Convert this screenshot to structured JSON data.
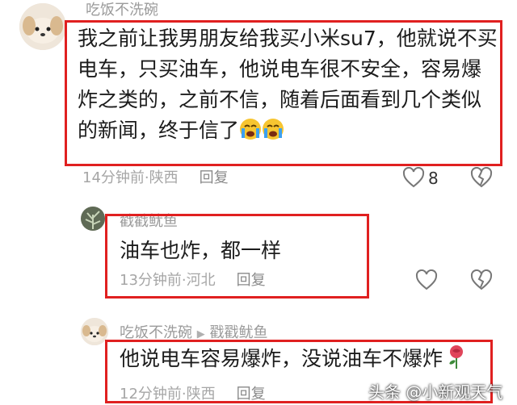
{
  "comments": [
    {
      "username": "吃饭不洗碗",
      "text_lines": [
        "我之前让我男朋友给我买小米su7，他就说不买",
        "电车，只买油车，他说电车很不安全，容易爆",
        "炸之类的，之前不信，随着后面看到几个类似",
        "的新闻，终于信了"
      ],
      "emoji": "crying-face-emoji",
      "time": "14分钟前",
      "location": "陕西",
      "reply_label": "回复",
      "like_count": "8"
    },
    {
      "username": "戳戳鱿鱼",
      "text": "油车也炸，都一样",
      "time": "13分钟前",
      "location": "河北",
      "reply_label": "回复"
    },
    {
      "username": "吃饭不洗碗",
      "reply_to": "戳戳鱿鱼",
      "text": "他说电车容易爆炸，没说油车不爆炸",
      "emoji": "rose-emoji",
      "time": "12分钟前",
      "location": "陕西",
      "reply_label": "回复"
    }
  ],
  "watermark": "头条 @小新观天气",
  "colors": {
    "highlight_box": "#e02020",
    "meta_text": "#a6a6a6"
  }
}
